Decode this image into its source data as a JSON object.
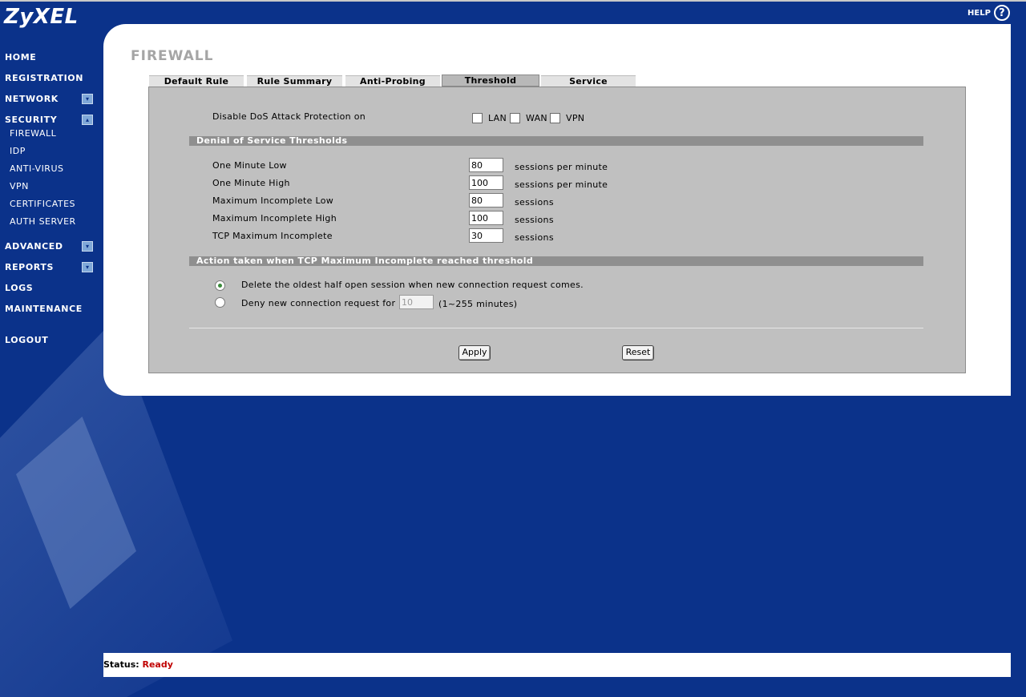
{
  "brand": "ZyXEL",
  "help_label": "HELP",
  "help_icon_glyph": "?",
  "nav": {
    "home": "HOME",
    "registration": "REGISTRATION",
    "network": "NETWORK",
    "security": "SECURITY",
    "security_items": [
      "FIREWALL",
      "IDP",
      "ANTI-VIRUS",
      "VPN",
      "CERTIFICATES",
      "AUTH SERVER"
    ],
    "advanced": "ADVANCED",
    "reports": "REPORTS",
    "logs": "LOGS",
    "maintenance": "MAINTENANCE",
    "logout": "LOGOUT",
    "expand_glyph": "▾",
    "collapse_glyph": "▴"
  },
  "page_title": "FIREWALL",
  "tabs": [
    "Default Rule",
    "Rule Summary",
    "Anti-Probing",
    "Threshold",
    "Service"
  ],
  "active_tab": "Threshold",
  "dos": {
    "label": "Disable DoS Attack Protection on",
    "options": [
      "LAN",
      "WAN",
      "VPN"
    ],
    "checked": [
      false,
      false,
      false
    ]
  },
  "thresholds": {
    "header": "Denial of Service Thresholds",
    "rows": [
      {
        "label": "One Minute Low",
        "value": "80",
        "unit": "sessions per minute"
      },
      {
        "label": "One Minute High",
        "value": "100",
        "unit": "sessions per minute"
      },
      {
        "label": "Maximum Incomplete Low",
        "value": "80",
        "unit": "sessions"
      },
      {
        "label": "Maximum Incomplete High",
        "value": "100",
        "unit": "sessions"
      },
      {
        "label": "TCP Maximum Incomplete",
        "value": "30",
        "unit": "sessions"
      }
    ]
  },
  "action": {
    "header": "Action taken when TCP Maximum Incomplete reached threshold",
    "option1": "Delete the oldest half open session when new connection request comes.",
    "option2_prefix": "Deny new connection request for",
    "option2_value": "10",
    "option2_suffix": "(1~255 minutes)",
    "selected": 1
  },
  "buttons": {
    "apply": "Apply",
    "reset": "Reset"
  },
  "status": {
    "label": "Status:",
    "value": "Ready"
  },
  "colors": {
    "background": "#0b328a",
    "status_ready": "#c00000",
    "section_bar": "#8f8f8f"
  }
}
